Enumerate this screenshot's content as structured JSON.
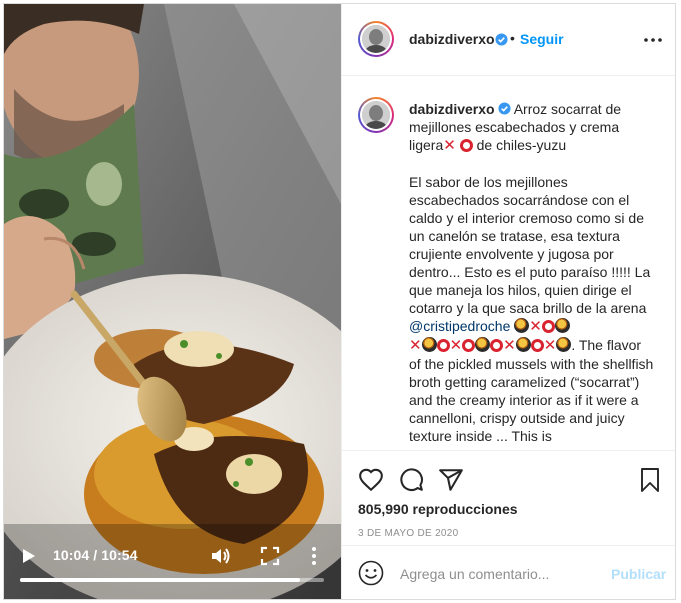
{
  "post": {
    "username": "dabizdiverxo",
    "follow_label": "Seguir",
    "separator": "•",
    "caption": {
      "username": "dabizdiverxo",
      "title": "Arroz socarrat de mejillones escabechados y crema ligera",
      "title_tail": "de chiles-yuzu",
      "body_es": "El sabor de los mejillones escabechados socarrándose con el caldo y el interior cremoso como si de un canelón se tratase, esa textura crujiente envolvente y jugosa por dentro... Esto es el puto paraíso !!!!! La que maneja los hilos, quien dirige el cotarro y la que saca brillo de la arena",
      "mention": "@cristipedroche",
      "body_en": ". The flavor of the pickled mussels with the shellfish broth getting caramelized (“socarrat”) and the creamy interior as if it were a cannelloni, crispy outside and juicy texture inside ... This is",
      "emoji_line_1": [
        "paella",
        "x",
        "o",
        "paella"
      ],
      "emoji_line_2": [
        "x",
        "paella",
        "o",
        "x",
        "o",
        "paella",
        "o",
        "x",
        "paella",
        "o",
        "x",
        "paella"
      ]
    },
    "views": "805,990 reproducciones",
    "date": "3 DE MAYO DE 2020",
    "comment_placeholder": "Agrega un comentario...",
    "publish_label": "Publicar"
  },
  "video": {
    "time": "10:04 / 10:54",
    "progress": 0.92
  },
  "icons": {
    "verified": "verified-badge-icon",
    "more": "more-horizontal-icon",
    "like": "heart-icon",
    "comment": "comment-bubble-icon",
    "share": "paper-plane-icon",
    "save": "bookmark-icon",
    "emoji": "smiley-icon",
    "play": "play-icon",
    "volume": "volume-icon",
    "fullscreen": "fullscreen-icon",
    "video_more": "more-vertical-icon"
  },
  "colors": {
    "accent": "#0095f6",
    "publish_disabled": "#b2dffc",
    "mention": "#00376b",
    "muted": "#8e8e8e",
    "emoji_red": "#d9232e"
  }
}
